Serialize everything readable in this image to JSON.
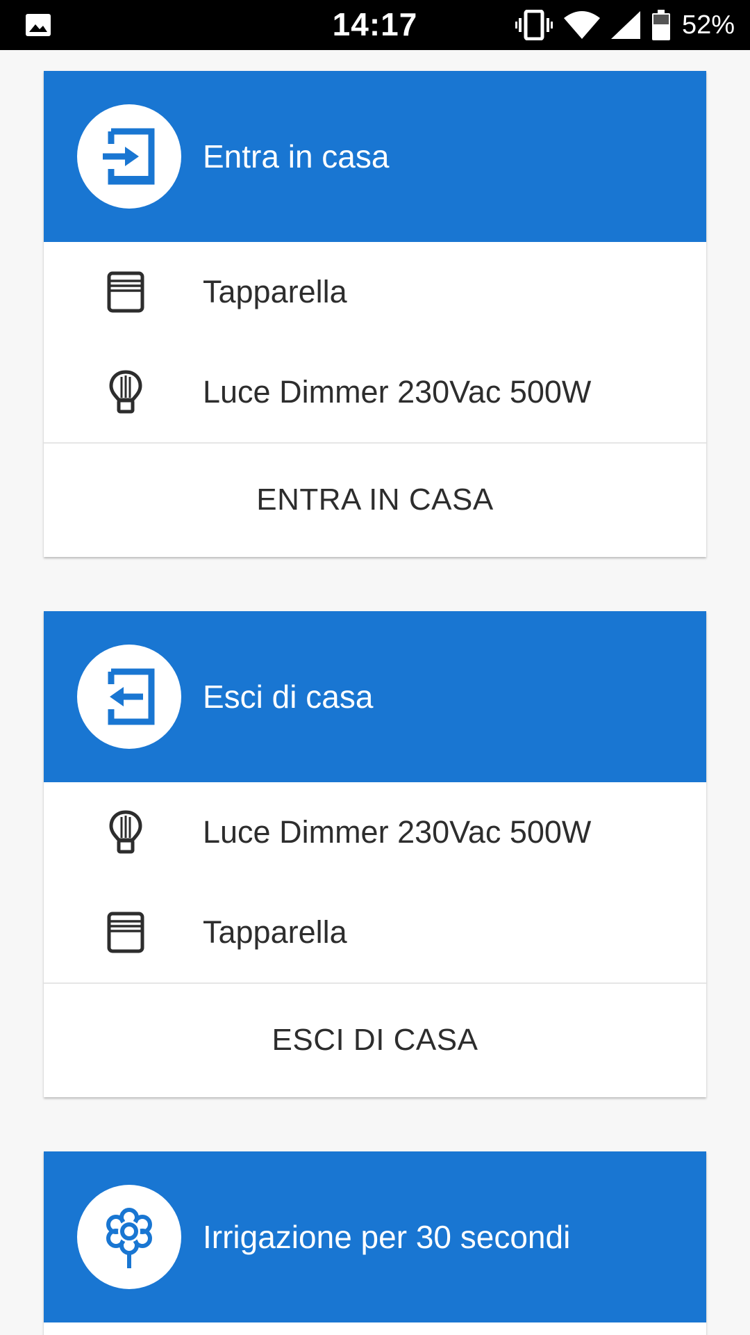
{
  "status_bar": {
    "time": "14:17",
    "battery": "52%",
    "icons": [
      "image-icon",
      "vibrate-icon",
      "wifi-icon",
      "signal-icon",
      "battery-icon"
    ]
  },
  "theme": {
    "header_color": "#1976d2",
    "text_color": "#2d2d2d"
  },
  "cards": [
    {
      "title": "Entra in casa",
      "icon": "login-icon",
      "items": [
        {
          "label": "Tapparella",
          "icon": "shutter-icon"
        },
        {
          "label": "Luce Dimmer 230Vac 500W",
          "icon": "bulb-icon"
        }
      ],
      "action": "ENTRA IN CASA"
    },
    {
      "title": "Esci di casa",
      "icon": "logout-icon",
      "items": [
        {
          "label": "Luce Dimmer 230Vac 500W",
          "icon": "bulb-icon"
        },
        {
          "label": "Tapparella",
          "icon": "shutter-icon"
        }
      ],
      "action": "ESCI DI CASA"
    },
    {
      "title": "Irrigazione per 30 secondi",
      "icon": "flower-icon"
    }
  ]
}
